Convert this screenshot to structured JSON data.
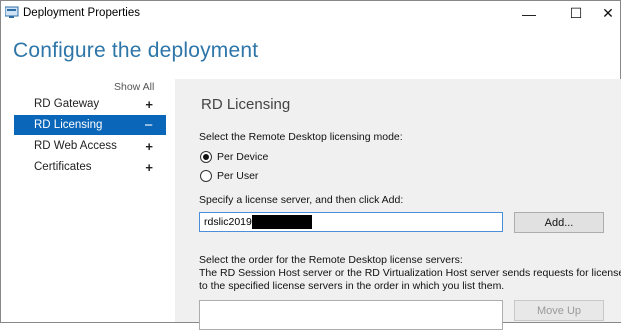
{
  "window": {
    "title": "Deployment Properties"
  },
  "controls": {
    "minimize": "—",
    "maximize": "☐",
    "close": "✕"
  },
  "heading": "Configure the deployment",
  "nav": {
    "show_all": "Show All",
    "items": [
      {
        "label": "RD Gateway",
        "sign": "+"
      },
      {
        "label": "RD Licensing",
        "sign": "−"
      },
      {
        "label": "RD Web Access",
        "sign": "+"
      },
      {
        "label": "Certificates",
        "sign": "+"
      }
    ]
  },
  "panel": {
    "title": "RD Licensing",
    "mode_label": "Select the Remote Desktop licensing mode:",
    "per_device": "Per Device",
    "per_user": "Per User",
    "selected_mode": "Per Device",
    "server_label": "Specify a license server, and then click Add:",
    "server_value": "rdslic2019",
    "add_button": "Add...",
    "order_line1": "Select the order for the Remote Desktop license servers:",
    "order_line2": "The RD Session Host server or the RD Virtualization Host server sends requests for licenses",
    "order_line3": "to the specified license servers in the order in which you list them.",
    "move_up_button": "Move Up"
  },
  "colors": {
    "accent": "#0a66b8",
    "heading": "#2e75a8",
    "panel_bg": "#f0f0f0"
  }
}
